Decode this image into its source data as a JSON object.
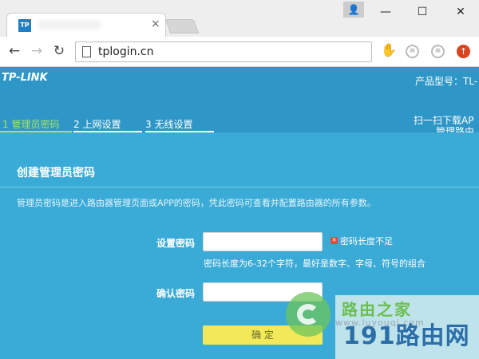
{
  "browser": {
    "tab_favicon": "TP",
    "tab_close": "×",
    "window_controls": {
      "user": "👤",
      "minimize": "—",
      "maximize": "☐",
      "close": "✕"
    },
    "nav": {
      "back": "←",
      "forward": "→",
      "reload": "↻"
    },
    "url": "tplogin.cn",
    "extensions": [
      "puzzle-icon",
      "ext-icon-1",
      "ext-icon-2",
      "tampermonkey-icon"
    ]
  },
  "header": {
    "brand": "TP-LINK",
    "model_label": "产品型号：TL-",
    "steps": [
      {
        "label": "1 管理员密码",
        "color": "#a7e363"
      },
      {
        "label": "2 上网设置",
        "color": "#ffffff"
      },
      {
        "label": "3 无线设置",
        "color": "#ffffff"
      }
    ],
    "scan_line1": "扫一扫下载AP",
    "scan_line2": "管理路由",
    "scan_line3": "·"
  },
  "panel": {
    "title": "创建管理员密码",
    "description": "管理员密码是进入路由器管理页面或APP的密码，凭此密码可查看并配置路由器的所有参数。",
    "password_label": "设置密码",
    "password_value": "",
    "error_text": "密码长度不足",
    "hint": "密码长度为6-32个字符，最好是数字、字母、符号的组合",
    "confirm_label": "确认密码",
    "confirm_value": "",
    "confirm_button": "确 定"
  },
  "watermark": {
    "line1": "路由之家",
    "line2": "www.luyouqi.com",
    "line3": "191路由网"
  },
  "colors": {
    "header_bg": "#2e97c7",
    "content_bg": "#3aaad6",
    "active_step": "#a7e363",
    "button_bg": "#f2e95a",
    "error": "#e8473e"
  }
}
